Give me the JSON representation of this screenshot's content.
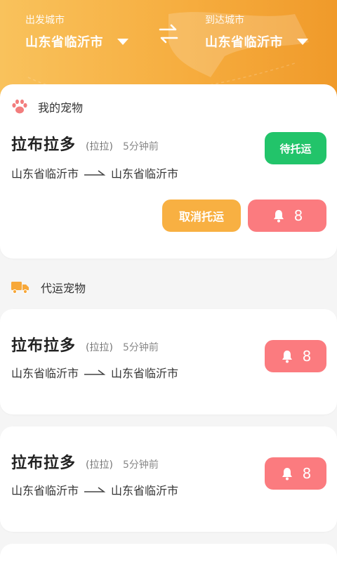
{
  "header": {
    "from_label": "出发城市",
    "from_value": "山东省临沂市",
    "to_label": "到达城市",
    "to_value": "山东省临沂市"
  },
  "my_pets": {
    "title": "我的宠物",
    "item": {
      "name": "拉布拉多",
      "nickname": "(拉拉)",
      "time": "5分钟前",
      "from": "山东省临沂市",
      "to": "山东省临沂市",
      "status": "待托运",
      "cancel": "取消托运",
      "bell_count": "8"
    }
  },
  "proxy_pets": {
    "title": "代运宠物",
    "items": [
      {
        "name": "拉布拉多",
        "nickname": "(拉拉)",
        "time": "5分钟前",
        "from": "山东省临沂市",
        "to": "山东省临沂市",
        "bell_count": "8"
      },
      {
        "name": "拉布拉多",
        "nickname": "(拉拉)",
        "time": "5分钟前",
        "from": "山东省临沂市",
        "to": "山东省临沂市",
        "bell_count": "8"
      }
    ]
  },
  "colors": {
    "header_start": "#f9c25c",
    "header_end": "#f09a2a",
    "status_green": "#22c46a",
    "cancel_orange": "#f8b042",
    "bell_red": "#fb7b7f",
    "paw_red": "#f27d7d",
    "truck_orange": "#f7a83a"
  }
}
